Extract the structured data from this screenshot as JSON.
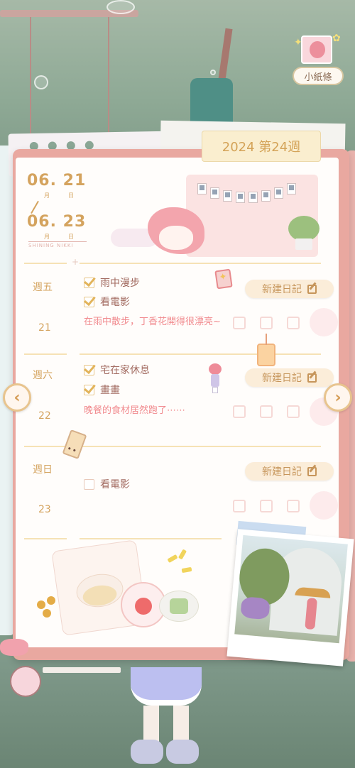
{
  "note_button": {
    "label": "小紙條",
    "icon": "avatar-sticker-icon"
  },
  "week_tab": {
    "label": "2024 第24週"
  },
  "date_range": {
    "start": "06. 21",
    "end": "06. 23",
    "month_label": "月",
    "day_label": "日",
    "brand": "SHINING NIKKI"
  },
  "new_entry_label": "新建日記",
  "days": [
    {
      "weekday": "週五",
      "date": "21",
      "tasks": [
        {
          "label": "雨中漫步",
          "checked": true
        },
        {
          "label": "看電影",
          "checked": true
        }
      ],
      "note": "在雨中散步，丁香花開得很漂亮~"
    },
    {
      "weekday": "週六",
      "date": "22",
      "tasks": [
        {
          "label": "宅在家休息",
          "checked": true
        },
        {
          "label": "畫畫",
          "checked": true
        }
      ],
      "note": "晚餐的食材居然跑了⋯⋯"
    },
    {
      "weekday": "週日",
      "date": "23",
      "tasks": [
        {
          "label": "看電影",
          "checked": false
        }
      ],
      "note": ""
    }
  ],
  "nav": {
    "prev_icon": "chevron-left-icon",
    "next_icon": "chevron-right-icon",
    "prev": "‹",
    "next": "›"
  },
  "colors": {
    "accent": "#d4a35e",
    "note_text": "#f18a8e",
    "notebook_border": "#e9a8a0",
    "button_bg": "#fbedd9"
  }
}
